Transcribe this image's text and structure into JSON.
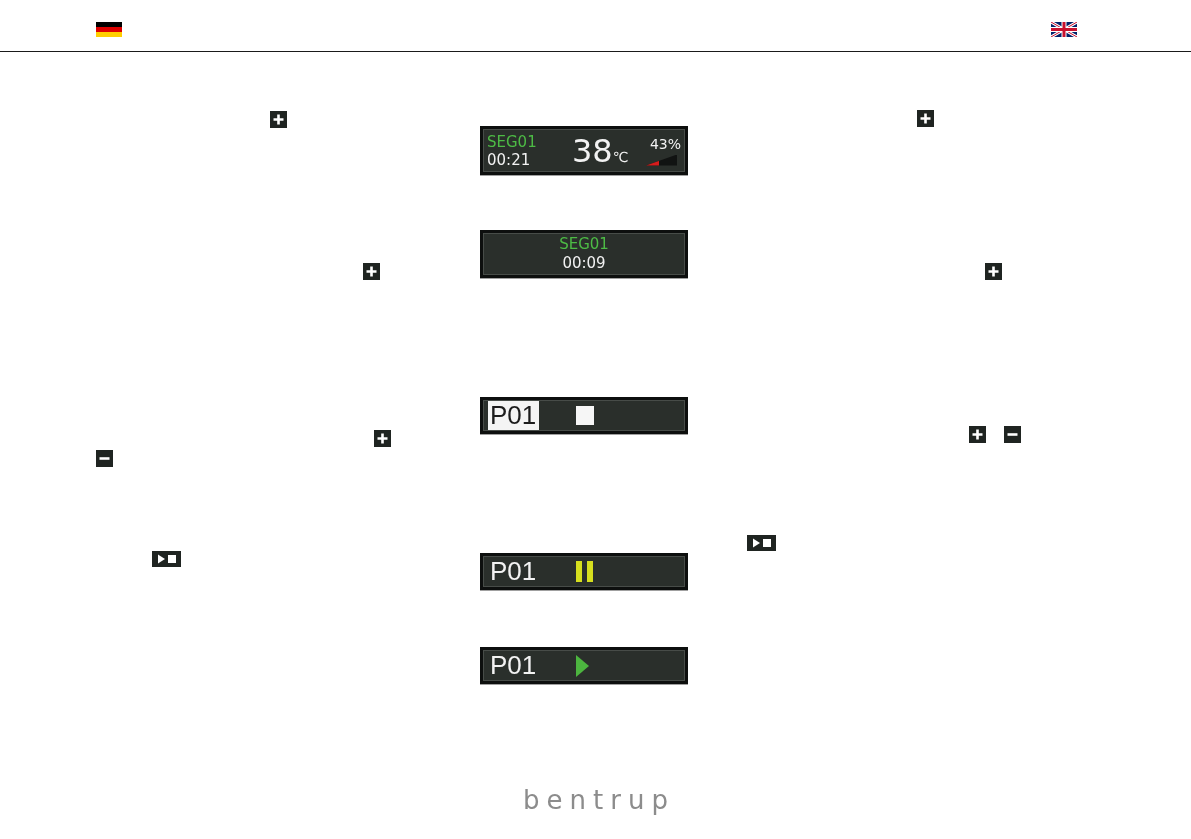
{
  "header": {
    "flags": [
      {
        "kind": "german"
      },
      {
        "kind": "uk"
      }
    ]
  },
  "left_column": {
    "lines": [
      {
        "icons": [
          {
            "kind": "plus"
          }
        ]
      },
      {
        "icons": [
          {
            "kind": "plus"
          }
        ]
      },
      {
        "icons": [
          {
            "kind": "plus"
          }
        ]
      },
      {
        "icons": [
          {
            "kind": "minus"
          }
        ]
      },
      {
        "icons": [
          {
            "kind": "play-stop"
          }
        ]
      }
    ]
  },
  "displays": [
    {
      "kind": "status",
      "segment": "SEG01",
      "time": "00:21",
      "temperature": "38",
      "unit": "℃",
      "power": "43%",
      "level": 0.43
    },
    {
      "kind": "segment",
      "segment": "SEG01",
      "time": "00:09"
    },
    {
      "kind": "program",
      "program": "P01",
      "selected": true,
      "indicator": {
        "kind": "stop"
      }
    },
    {
      "kind": "program",
      "program": "P01",
      "selected": false,
      "indicator": {
        "kind": "pause"
      }
    },
    {
      "kind": "program",
      "program": "P01",
      "selected": false,
      "indicator": {
        "kind": "play"
      }
    }
  ],
  "right_column": {
    "lines": [
      {
        "icons": [
          {
            "kind": "plus"
          }
        ]
      },
      {
        "icons": [
          {
            "kind": "plus"
          }
        ]
      },
      {
        "icons": [
          {
            "kind": "plus"
          },
          {
            "kind": "minus"
          }
        ]
      },
      {
        "icons": [
          {
            "kind": "play-stop"
          }
        ]
      }
    ]
  },
  "footer": {
    "logo": "bentrup"
  }
}
